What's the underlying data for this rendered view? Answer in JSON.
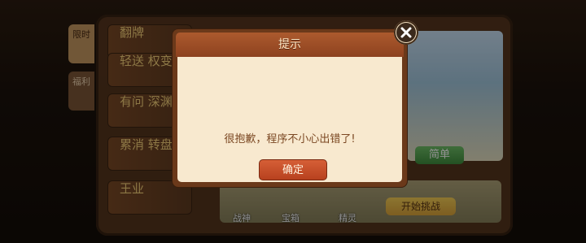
{
  "game": {
    "menu_items": [
      "翻牌",
      "轻送 权变",
      "有问 深渊",
      "累消 转盘",
      "王业"
    ],
    "side_tabs": [
      "限时",
      "福利"
    ],
    "labels": {
      "simple": "简单",
      "start": "开始挑战",
      "bottom_1": "战神",
      "bottom_2": "宝箱",
      "bottom_3": "精灵"
    }
  },
  "dialog": {
    "title": "提示",
    "message": "很抱歉，程序不小心出错了!",
    "ok_label": "确定"
  },
  "colors": {
    "dialog_border": "#6b391a",
    "dialog_title": "#a8572b",
    "dialog_body": "#f8e9cf",
    "ok_button": "#c95031"
  }
}
